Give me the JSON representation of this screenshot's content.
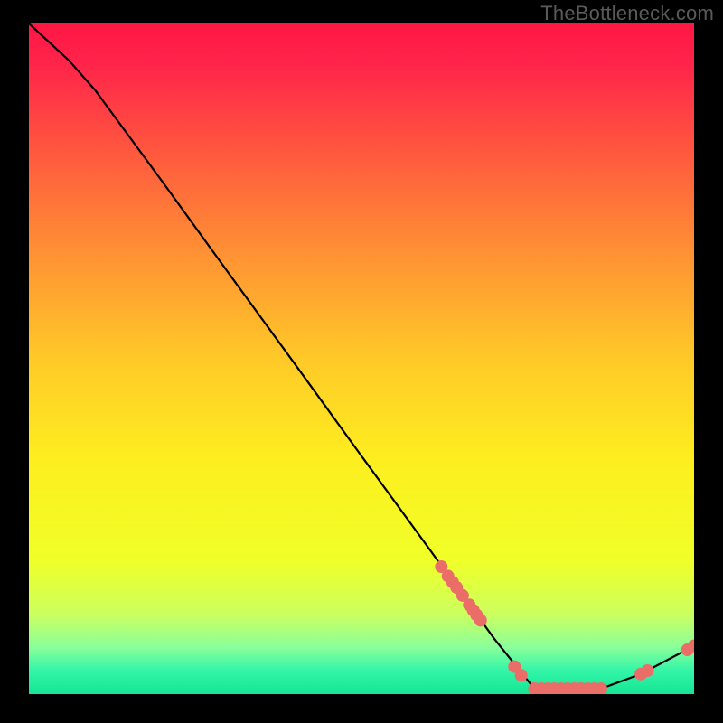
{
  "watermark": "TheBottleneck.com",
  "chart_data": {
    "type": "line",
    "title": "",
    "xlabel": "",
    "ylabel": "",
    "xlim": [
      0,
      100
    ],
    "ylim": [
      0,
      100
    ],
    "curve": [
      {
        "x": 0,
        "y": 100
      },
      {
        "x": 6,
        "y": 94.5
      },
      {
        "x": 10,
        "y": 90
      },
      {
        "x": 20,
        "y": 76.5
      },
      {
        "x": 30,
        "y": 62.8
      },
      {
        "x": 40,
        "y": 49.2
      },
      {
        "x": 50,
        "y": 35.5
      },
      {
        "x": 60,
        "y": 21.9
      },
      {
        "x": 70,
        "y": 8.2
      },
      {
        "x": 76,
        "y": 0.8
      },
      {
        "x": 80,
        "y": 0.8
      },
      {
        "x": 86,
        "y": 0.8
      },
      {
        "x": 92,
        "y": 3.0
      },
      {
        "x": 100,
        "y": 7.2
      }
    ],
    "dot_groups": [
      {
        "x": 62.0,
        "y": 19.0
      },
      {
        "x": 63.0,
        "y": 17.6
      },
      {
        "x": 63.7,
        "y": 16.7
      },
      {
        "x": 64.3,
        "y": 15.9
      },
      {
        "x": 65.2,
        "y": 14.7
      },
      {
        "x": 66.2,
        "y": 13.3
      },
      {
        "x": 66.8,
        "y": 12.5
      },
      {
        "x": 67.3,
        "y": 11.8
      },
      {
        "x": 67.9,
        "y": 11.0
      },
      {
        "x": 73.0,
        "y": 4.1
      },
      {
        "x": 74.0,
        "y": 2.8
      },
      {
        "x": 76.0,
        "y": 0.8
      },
      {
        "x": 77.0,
        "y": 0.8
      },
      {
        "x": 78.0,
        "y": 0.8
      },
      {
        "x": 79.0,
        "y": 0.8
      },
      {
        "x": 80.0,
        "y": 0.8
      },
      {
        "x": 81.0,
        "y": 0.8
      },
      {
        "x": 82.0,
        "y": 0.8
      },
      {
        "x": 83.0,
        "y": 0.8
      },
      {
        "x": 84.0,
        "y": 0.8
      },
      {
        "x": 85.0,
        "y": 0.8
      },
      {
        "x": 86.0,
        "y": 0.8
      },
      {
        "x": 92.0,
        "y": 3.0
      },
      {
        "x": 93.0,
        "y": 3.5
      },
      {
        "x": 99.0,
        "y": 6.6
      },
      {
        "x": 100.0,
        "y": 7.2
      }
    ],
    "dot_color": "#ea6d68",
    "dot_radius": 7,
    "line_color": "#000000",
    "gradient_stops": [
      {
        "offset": 0.0,
        "color": "#ff1744"
      },
      {
        "offset": 0.06,
        "color": "#ff244a"
      },
      {
        "offset": 0.2,
        "color": "#ff5b3e"
      },
      {
        "offset": 0.35,
        "color": "#ff9433"
      },
      {
        "offset": 0.5,
        "color": "#ffc928"
      },
      {
        "offset": 0.65,
        "color": "#fdee1f"
      },
      {
        "offset": 0.8,
        "color": "#f0ff28"
      },
      {
        "offset": 0.88,
        "color": "#ccff5e"
      },
      {
        "offset": 0.93,
        "color": "#8aff9a"
      },
      {
        "offset": 0.965,
        "color": "#33f5a8"
      },
      {
        "offset": 1.0,
        "color": "#15e594"
      }
    ]
  }
}
